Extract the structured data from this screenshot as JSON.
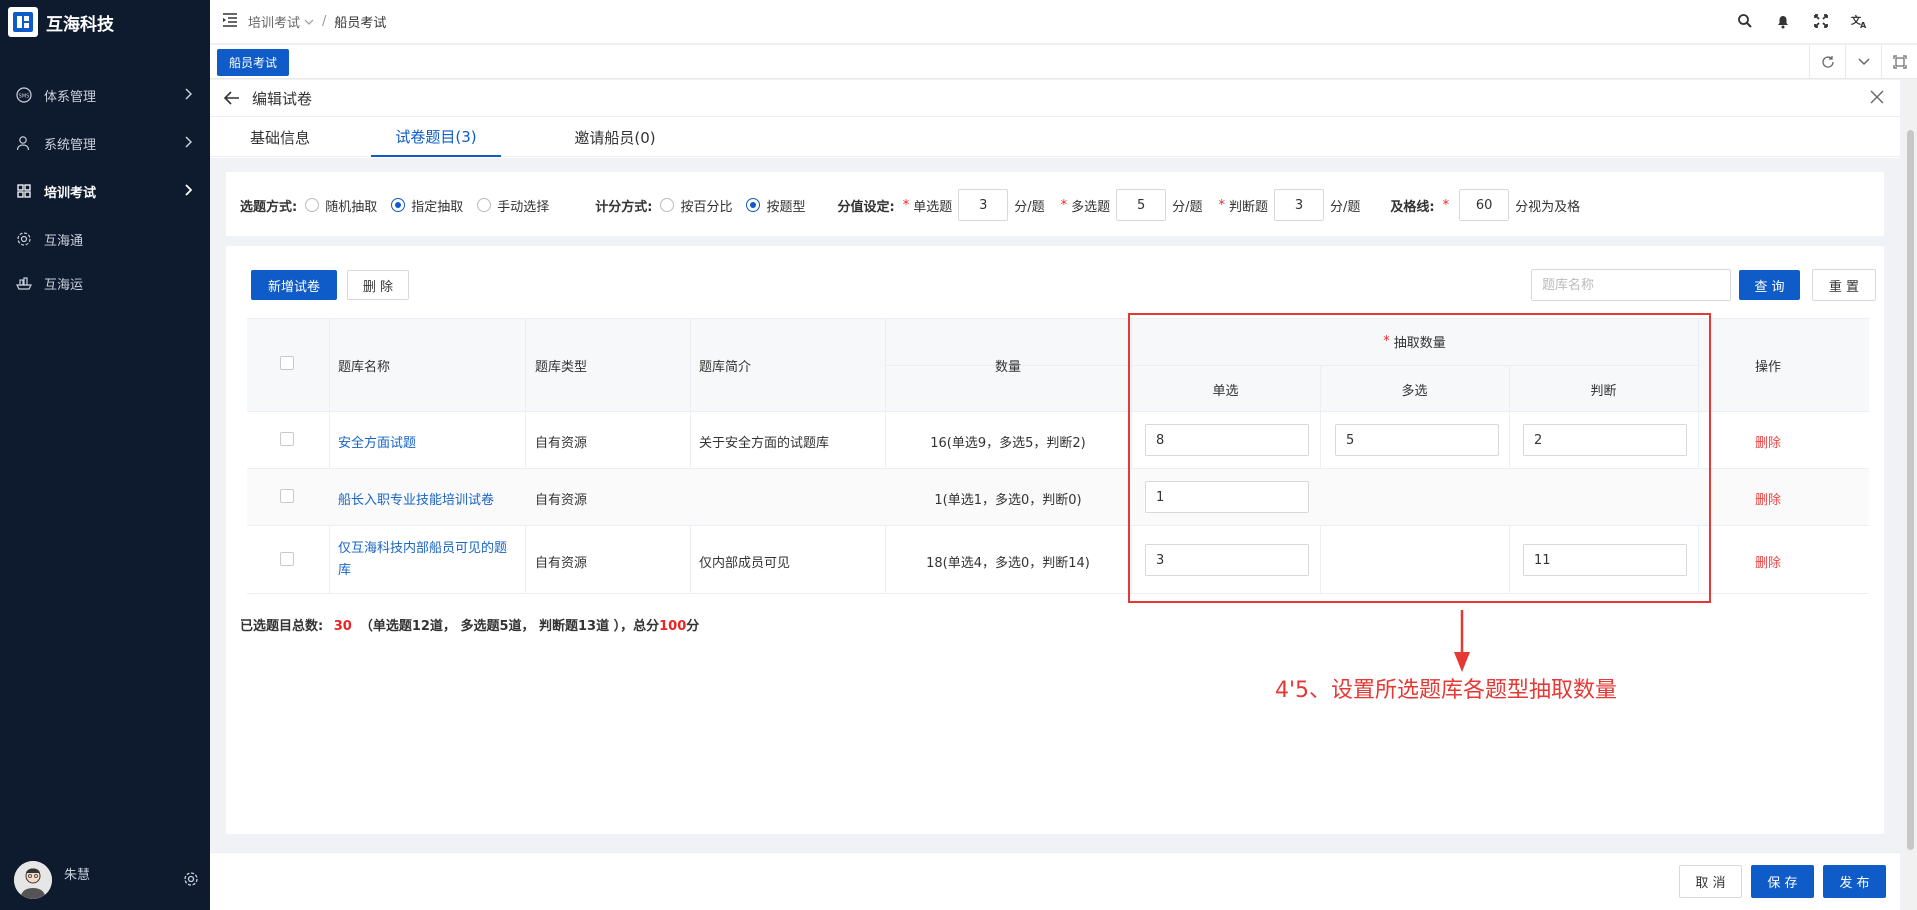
{
  "app": {
    "brand": "互海科技"
  },
  "sidebar": {
    "items": [
      {
        "label": "体系管理",
        "icon": "sms-icon",
        "expandable": true
      },
      {
        "label": "系统管理",
        "icon": "user-icon",
        "expandable": true
      },
      {
        "label": "培训考试",
        "icon": "grid-icon",
        "expandable": true,
        "active": true
      },
      {
        "label": "互海通",
        "icon": "gear-icon",
        "expandable": false
      },
      {
        "label": "互海运",
        "icon": "ship-icon",
        "expandable": false
      }
    ],
    "user": {
      "name": "朱慧"
    }
  },
  "header": {
    "breadcrumb": [
      "培训考试",
      "船员考试"
    ]
  },
  "tabbar": {
    "active_tab": "船员考试"
  },
  "panel": {
    "title": "编辑试卷",
    "tabs": [
      {
        "label": "基础信息",
        "active": false
      },
      {
        "label": "试卷题目(3)",
        "active": true
      },
      {
        "label": "邀请船员(0)",
        "active": false
      }
    ]
  },
  "settings": {
    "select_mode_label": "选题方式:",
    "select_modes": [
      {
        "label": "随机抽取",
        "checked": false
      },
      {
        "label": "指定抽取",
        "checked": true
      },
      {
        "label": "手动选择",
        "checked": false
      }
    ],
    "score_mode_label": "计分方式:",
    "score_modes": [
      {
        "label": "按百分比",
        "checked": false
      },
      {
        "label": "按题型",
        "checked": true
      }
    ],
    "score_setting_label": "分值设定:",
    "single_label": "单选题",
    "single_value": "3",
    "multi_label": "多选题",
    "multi_value": "5",
    "judge_label": "判断题",
    "judge_value": "3",
    "per_unit": "分/题",
    "pass_label": "及格线:",
    "pass_value": "60",
    "pass_suffix": "分视为及格"
  },
  "toolbar": {
    "add_label": "新增试卷",
    "delete_label": "删 除",
    "search_placeholder": "题库名称",
    "query_label": "查 询",
    "reset_label": "重 置"
  },
  "table": {
    "headers": {
      "name": "题库名称",
      "type": "题库类型",
      "intro": "题库简介",
      "count": "数量",
      "extract": "抽取数量",
      "single": "单选",
      "multi": "多选",
      "judge": "判断",
      "op": "操作"
    },
    "rows": [
      {
        "name": "安全方面试题",
        "type": "自有资源",
        "intro": "关于安全方面的试题库",
        "count": "16(单选9，多选5，判断2)",
        "single": "8",
        "multi": "5",
        "judge": "2",
        "op": "删除"
      },
      {
        "name": "船长入职专业技能培训试卷",
        "type": "自有资源",
        "intro": "",
        "count": "1(单选1，多选0，判断0)",
        "single": "1",
        "multi": null,
        "judge": null,
        "op": "删除"
      },
      {
        "name": "仅互海科技内部船员可见的题库",
        "type": "自有资源",
        "intro": "仅内部成员可见",
        "count": "18(单选4，多选0，判断14)",
        "single": "3",
        "multi": null,
        "judge": "11",
        "op": "删除"
      }
    ]
  },
  "summary": {
    "prefix": "已选题目总数:",
    "total": "30",
    "detail": "（单选题12道， 多选题5道， 判断题13道 ），总分",
    "score": "100",
    "suffix": "分"
  },
  "annotation": {
    "text": "4'5、设置所选题库各题型抽取数量",
    "color": "#e53935"
  },
  "footer": {
    "cancel_label": "取 消",
    "save_label": "保 存",
    "publish_label": "发 布"
  },
  "colors": {
    "primary": "#0f5cc8",
    "sidebar_bg": "#0e1b2f",
    "danger": "#e44444",
    "highlight": "#e53935"
  }
}
